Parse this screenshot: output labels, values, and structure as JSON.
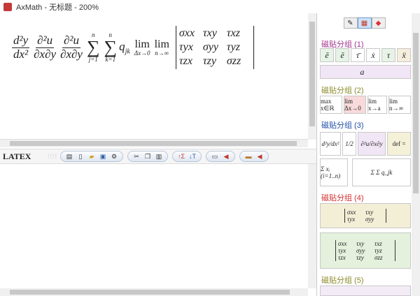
{
  "window": {
    "title": "AxMath - 无标题 - 200%"
  },
  "preview": {
    "frac1_num": "d²y",
    "frac1_den": "dx²",
    "frac2_num": "∂²u",
    "frac2_den": "∂x∂y",
    "frac3_num": "∂²u",
    "frac3_den": "∂x∂y",
    "sum1_top": "n",
    "sum1_bottom": "j=1",
    "sum2_top": "n",
    "sum2_bottom": "k=1",
    "term": "q",
    "term_sub": "jk",
    "lim1_sub": "Δx→0",
    "lim2_sub": "n→∞",
    "lim_word": "lim",
    "matrix": [
      "σxx",
      "τxy",
      "τxz",
      "τyx",
      "σyy",
      "τyz",
      "τzx",
      "τzy",
      "σzz"
    ]
  },
  "toolbar": {
    "latex_label": "LATEX"
  },
  "panel": {
    "groups": [
      {
        "title": "磁贴分组 (1)",
        "color": "#a0348f"
      },
      {
        "title": "磁贴分组 (2)",
        "color": "#8a8a2a"
      },
      {
        "title": "磁贴分组 (3)",
        "color": "#1f4fa3"
      },
      {
        "title": "磁贴分组 (4)",
        "color": "#d32f2f"
      },
      {
        "title": "磁贴分组 (5)",
        "color": "#8a8a2a"
      }
    ],
    "g1_tiles": [
      "ē",
      "ē",
      "τ̄",
      "ẋ",
      "τ",
      "ẍ"
    ],
    "g1_wide": "a⃗",
    "g2_tiles": [
      "max x∈ℝ",
      "lim Δx→0",
      "lim x→a",
      "lim n→∞"
    ],
    "g3_tiles": [
      "d²y/dx²",
      "1/2",
      "∂²u/∂x∂y",
      "def ="
    ],
    "g3_row2": [
      "Σ xᵢ (i=1..n)",
      "Σ Σ q_jk"
    ],
    "g4_m2": [
      "σxx",
      "τxy",
      "τyx",
      "σyy"
    ],
    "g4_m3": [
      "σxx",
      "τxy",
      "τxz",
      "τyx",
      "σyy",
      "τyz",
      "τzx",
      "τzy",
      "σzz"
    ]
  }
}
